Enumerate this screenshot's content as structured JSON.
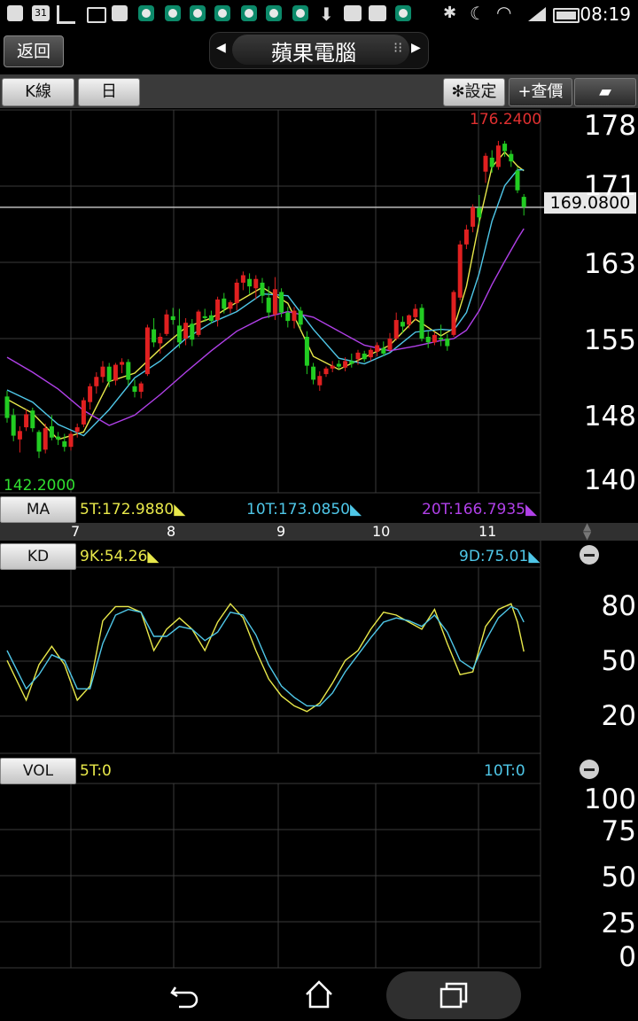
{
  "status_bar": {
    "time": "08:19",
    "calendar_day": "31"
  },
  "header": {
    "back_label": "返回",
    "title": "蘋果電腦"
  },
  "toolbar": {
    "kline_label": "K線",
    "period_label": "日",
    "settings_label": "設定",
    "quote_label": "+查價"
  },
  "price_axis": {
    "labels": [
      "178",
      "171",
      "163",
      "155",
      "148",
      "140"
    ]
  },
  "price_panel": {
    "high_label": "176.2400",
    "low_label": "142.2000",
    "last_price": "169.0800"
  },
  "ma_legend": {
    "button": "MA",
    "ma5": "5T:172.9880",
    "ma10": "10T:173.0850",
    "ma20": "20T:166.7935",
    "colors": {
      "ma5": "#e8e84a",
      "ma10": "#4fc7e8",
      "ma20": "#b040e8"
    }
  },
  "time_axis": {
    "labels": [
      "7",
      "8",
      "9",
      "10",
      "11"
    ]
  },
  "kd": {
    "button": "KD",
    "k_label": "9K:54.26",
    "d_label": "9D:75.01",
    "axis": [
      "80",
      "50",
      "20"
    ]
  },
  "vol": {
    "button": "VOL",
    "ma5_label": "5T:0",
    "ma10_label": "10T:0",
    "axis": [
      "100",
      "75",
      "50",
      "25",
      "0"
    ]
  },
  "chart_data": {
    "type": "candlestick",
    "ylim": [
      140,
      178
    ],
    "up_color": "#e02020",
    "down_color": "#22cc22",
    "candles": [
      [
        148.8,
        149.4,
        146.0,
        146.5
      ],
      [
        146.8,
        147.5,
        144.0,
        144.6
      ],
      [
        144.2,
        145.6,
        142.8,
        145.1
      ],
      [
        145.5,
        147.4,
        145.1,
        146.9
      ],
      [
        147.3,
        147.6,
        145.0,
        145.4
      ],
      [
        145.0,
        145.2,
        142.2,
        142.9
      ],
      [
        143.1,
        145.9,
        142.7,
        145.4
      ],
      [
        145.6,
        146.8,
        144.1,
        144.4
      ],
      [
        144.5,
        145.0,
        143.6,
        144.2
      ],
      [
        144.0,
        144.8,
        142.9,
        143.4
      ],
      [
        143.4,
        145.1,
        143.0,
        144.8
      ],
      [
        145.0,
        145.9,
        144.4,
        145.5
      ],
      [
        145.8,
        148.7,
        145.5,
        148.4
      ],
      [
        148.2,
        150.2,
        147.4,
        149.9
      ],
      [
        149.9,
        151.4,
        149.1,
        150.9
      ],
      [
        150.9,
        152.6,
        150.3,
        152.0
      ],
      [
        152.0,
        152.4,
        149.8,
        150.4
      ],
      [
        150.5,
        152.4,
        150.0,
        152.2
      ],
      [
        152.2,
        152.9,
        151.3,
        152.5
      ],
      [
        152.5,
        152.8,
        150.0,
        150.6
      ],
      [
        149.9,
        150.6,
        148.7,
        149.3
      ],
      [
        149.3,
        150.4,
        148.6,
        150.2
      ],
      [
        151.2,
        156.5,
        151.0,
        156.2
      ],
      [
        156.0,
        157.2,
        154.1,
        154.6
      ],
      [
        154.5,
        155.6,
        153.4,
        155.2
      ],
      [
        155.5,
        158.1,
        155.3,
        157.6
      ],
      [
        157.4,
        158.3,
        156.5,
        157.0
      ],
      [
        156.4,
        158.2,
        154.0,
        154.6
      ],
      [
        155.0,
        157.2,
        154.3,
        156.7
      ],
      [
        156.6,
        157.1,
        154.2,
        154.9
      ],
      [
        155.4,
        158.1,
        155.2,
        157.9
      ],
      [
        157.4,
        158.2,
        156.8,
        157.2
      ],
      [
        157.5,
        158.0,
        156.6,
        156.9
      ],
      [
        157.0,
        159.5,
        156.3,
        159.2
      ],
      [
        159.3,
        159.9,
        157.7,
        158.2
      ],
      [
        158.2,
        159.1,
        157.7,
        158.9
      ],
      [
        158.8,
        161.4,
        158.0,
        161.0
      ],
      [
        161.0,
        162.2,
        160.2,
        161.8
      ],
      [
        161.4,
        162.0,
        159.8,
        160.6
      ],
      [
        160.4,
        161.8,
        159.2,
        161.4
      ],
      [
        161.0,
        161.5,
        158.8,
        159.6
      ],
      [
        159.4,
        160.6,
        157.2,
        157.8
      ],
      [
        157.6,
        161.6,
        157.0,
        160.3
      ],
      [
        160.0,
        160.4,
        157.3,
        157.8
      ],
      [
        157.8,
        158.4,
        156.2,
        156.9
      ],
      [
        156.9,
        158.4,
        156.1,
        158.0
      ],
      [
        158.0,
        158.4,
        156.0,
        156.5
      ],
      [
        155.2,
        155.8,
        151.2,
        152.1
      ],
      [
        152.0,
        152.4,
        150.1,
        150.6
      ],
      [
        150.0,
        151.5,
        149.4,
        151.0
      ],
      [
        151.2,
        152.0,
        150.9,
        151.8
      ],
      [
        151.8,
        152.6,
        151.4,
        152.1
      ],
      [
        152.3,
        152.7,
        151.7,
        152.0
      ],
      [
        151.9,
        153.0,
        151.5,
        152.6
      ],
      [
        152.6,
        153.4,
        151.9,
        152.3
      ],
      [
        152.8,
        153.8,
        152.2,
        153.5
      ],
      [
        153.4,
        153.7,
        152.5,
        152.8
      ],
      [
        153.0,
        154.0,
        152.6,
        153.8
      ],
      [
        153.6,
        154.6,
        153.1,
        154.3
      ],
      [
        154.0,
        154.7,
        153.1,
        153.4
      ],
      [
        153.8,
        155.6,
        153.6,
        155.0
      ],
      [
        155.0,
        157.8,
        154.8,
        157.0
      ],
      [
        156.8,
        157.4,
        155.6,
        156.3
      ],
      [
        156.5,
        157.6,
        156.1,
        157.5
      ],
      [
        157.3,
        158.7,
        156.9,
        158.2
      ],
      [
        158.3,
        158.7,
        154.7,
        155.0
      ],
      [
        155.2,
        155.8,
        154.0,
        154.6
      ],
      [
        154.6,
        155.7,
        154.3,
        155.4
      ],
      [
        155.1,
        156.5,
        154.2,
        154.9
      ],
      [
        155.0,
        155.5,
        153.7,
        154.2
      ],
      [
        155.4,
        160.2,
        155.2,
        160.0
      ],
      [
        159.4,
        165.5,
        159.1,
        165.1
      ],
      [
        165.1,
        167.2,
        164.6,
        166.7
      ],
      [
        167.0,
        169.4,
        166.4,
        169.1
      ],
      [
        169.0,
        170.4,
        167.2,
        168.0
      ],
      [
        172.9,
        174.9,
        171.7,
        174.6
      ],
      [
        174.4,
        175.2,
        172.8,
        173.4
      ],
      [
        173.4,
        176.2,
        173.1,
        175.7
      ],
      [
        175.9,
        176.2,
        174.5,
        175.1
      ],
      [
        174.8,
        175.2,
        173.4,
        174.0
      ],
      [
        173.0,
        173.4,
        170.6,
        170.9
      ],
      [
        170.2,
        170.5,
        168.2,
        169.1
      ]
    ],
    "ma_series": [
      {
        "name": "5T",
        "color": "#e8e84a",
        "values": [
          [
            0,
            148.5
          ],
          [
            4,
            147.0
          ],
          [
            8,
            144.2
          ],
          [
            12,
            145.0
          ],
          [
            16,
            150.4
          ],
          [
            20,
            151.3
          ],
          [
            24,
            153.9
          ],
          [
            28,
            156.2
          ],
          [
            32,
            157.2
          ],
          [
            36,
            158.9
          ],
          [
            40,
            160.5
          ],
          [
            44,
            158.8
          ],
          [
            48,
            153.1
          ],
          [
            52,
            151.7
          ],
          [
            56,
            153.0
          ],
          [
            60,
            154.3
          ],
          [
            64,
            157.1
          ],
          [
            68,
            155.3
          ],
          [
            70,
            156.1
          ],
          [
            72,
            160.6
          ],
          [
            74,
            167.5
          ],
          [
            76,
            173.4
          ],
          [
            78,
            175.0
          ],
          [
            80,
            173.5
          ],
          [
            81,
            172.99
          ]
        ]
      },
      {
        "name": "10T",
        "color": "#4fc7e8",
        "values": [
          [
            0,
            149.5
          ],
          [
            4,
            148.2
          ],
          [
            8,
            145.8
          ],
          [
            12,
            144.6
          ],
          [
            16,
            147.4
          ],
          [
            20,
            150.8
          ],
          [
            24,
            152.6
          ],
          [
            28,
            155.0
          ],
          [
            32,
            156.7
          ],
          [
            36,
            157.9
          ],
          [
            40,
            159.8
          ],
          [
            44,
            159.6
          ],
          [
            48,
            156.0
          ],
          [
            52,
            152.9
          ],
          [
            56,
            152.3
          ],
          [
            60,
            153.5
          ],
          [
            64,
            155.7
          ],
          [
            68,
            156.0
          ],
          [
            70,
            155.9
          ],
          [
            72,
            157.8
          ],
          [
            74,
            162.0
          ],
          [
            76,
            167.6
          ],
          [
            78,
            171.4
          ],
          [
            80,
            173.1
          ],
          [
            81,
            173.085
          ]
        ]
      },
      {
        "name": "20T",
        "color": "#b040e8",
        "values": [
          [
            0,
            153.0
          ],
          [
            4,
            151.4
          ],
          [
            8,
            149.6
          ],
          [
            12,
            147.3
          ],
          [
            16,
            145.7
          ],
          [
            20,
            146.8
          ],
          [
            24,
            149.0
          ],
          [
            28,
            151.4
          ],
          [
            32,
            153.7
          ],
          [
            36,
            155.8
          ],
          [
            40,
            157.2
          ],
          [
            44,
            157.9
          ],
          [
            48,
            157.3
          ],
          [
            52,
            155.8
          ],
          [
            56,
            154.3
          ],
          [
            60,
            153.7
          ],
          [
            64,
            154.2
          ],
          [
            68,
            154.8
          ],
          [
            70,
            155.0
          ],
          [
            72,
            155.9
          ],
          [
            74,
            158.0
          ],
          [
            76,
            160.8
          ],
          [
            78,
            163.3
          ],
          [
            80,
            165.7
          ],
          [
            81,
            166.7935
          ]
        ]
      }
    ],
    "kd_ylim": [
      0,
      100
    ],
    "kd_series": [
      {
        "name": "9K",
        "color": "#e8e84a",
        "values": [
          [
            0,
            48
          ],
          [
            3,
            20
          ],
          [
            5,
            45
          ],
          [
            7,
            58
          ],
          [
            9,
            45
          ],
          [
            11,
            20
          ],
          [
            13,
            30
          ],
          [
            15,
            76
          ],
          [
            17,
            86
          ],
          [
            19,
            86
          ],
          [
            21,
            82
          ],
          [
            23,
            55
          ],
          [
            25,
            70
          ],
          [
            27,
            78
          ],
          [
            29,
            70
          ],
          [
            31,
            55
          ],
          [
            33,
            75
          ],
          [
            35,
            88
          ],
          [
            37,
            78
          ],
          [
            39,
            55
          ],
          [
            41,
            35
          ],
          [
            43,
            23
          ],
          [
            45,
            16
          ],
          [
            47,
            12
          ],
          [
            49,
            18
          ],
          [
            51,
            32
          ],
          [
            53,
            48
          ],
          [
            55,
            55
          ],
          [
            57,
            70
          ],
          [
            59,
            82
          ],
          [
            61,
            80
          ],
          [
            63,
            75
          ],
          [
            65,
            70
          ],
          [
            67,
            84
          ],
          [
            69,
            60
          ],
          [
            71,
            38
          ],
          [
            73,
            40
          ],
          [
            75,
            72
          ],
          [
            77,
            84
          ],
          [
            79,
            88
          ],
          [
            80,
            75
          ],
          [
            81,
            54.26
          ]
        ]
      },
      {
        "name": "9D",
        "color": "#4fc7e8",
        "values": [
          [
            0,
            55
          ],
          [
            3,
            28
          ],
          [
            5,
            38
          ],
          [
            7,
            52
          ],
          [
            9,
            48
          ],
          [
            11,
            28
          ],
          [
            13,
            28
          ],
          [
            15,
            60
          ],
          [
            17,
            80
          ],
          [
            19,
            84
          ],
          [
            21,
            82
          ],
          [
            23,
            65
          ],
          [
            25,
            65
          ],
          [
            27,
            72
          ],
          [
            29,
            70
          ],
          [
            31,
            62
          ],
          [
            33,
            68
          ],
          [
            35,
            82
          ],
          [
            37,
            80
          ],
          [
            39,
            66
          ],
          [
            41,
            45
          ],
          [
            43,
            30
          ],
          [
            45,
            22
          ],
          [
            47,
            16
          ],
          [
            49,
            16
          ],
          [
            51,
            25
          ],
          [
            53,
            40
          ],
          [
            55,
            52
          ],
          [
            57,
            64
          ],
          [
            59,
            75
          ],
          [
            61,
            78
          ],
          [
            63,
            76
          ],
          [
            65,
            72
          ],
          [
            67,
            80
          ],
          [
            69,
            68
          ],
          [
            71,
            48
          ],
          [
            73,
            42
          ],
          [
            75,
            62
          ],
          [
            77,
            78
          ],
          [
            79,
            86
          ],
          [
            80,
            84
          ],
          [
            81,
            75.01
          ]
        ]
      }
    ]
  }
}
